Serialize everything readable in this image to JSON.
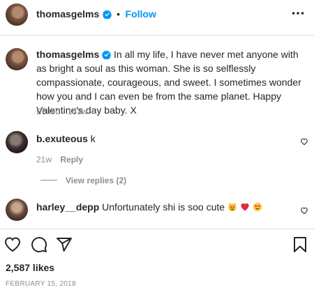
{
  "header": {
    "username": "thomasgelms",
    "separator": "•",
    "follow_label": "Follow",
    "more_icon": "more-horizontal-icon"
  },
  "caption": {
    "username": "thomasgelms",
    "text": "In all my life, I have never met anyone with as bright a soul as this woman. She is so selflessly compassionate, courageous, and sweet. I sometimes wonder how you and I can even be from the same planet. Happy Valentine's day baby. X",
    "meta": "Edited · 153w"
  },
  "comments": [
    {
      "username": "b.exuteous",
      "text": "k",
      "time": "21w",
      "reply_label": "Reply",
      "view_replies": "View replies (2)"
    },
    {
      "username": "harley__depp",
      "text": "Unfortunately shi is soo cute",
      "emojis": [
        "heart-eyes-cat-emoji",
        "red-heart-emoji",
        "heart-eyes-emoji"
      ]
    }
  ],
  "actions": {
    "icons": [
      "heart-icon",
      "comment-icon",
      "share-icon",
      "save-icon"
    ]
  },
  "likes": "2,587 likes",
  "date": "February 15, 2018",
  "colors": {
    "link_blue": "#0095f6",
    "muted": "#8e8e8e",
    "text": "#262626",
    "verified_blue": "#0095f6"
  }
}
